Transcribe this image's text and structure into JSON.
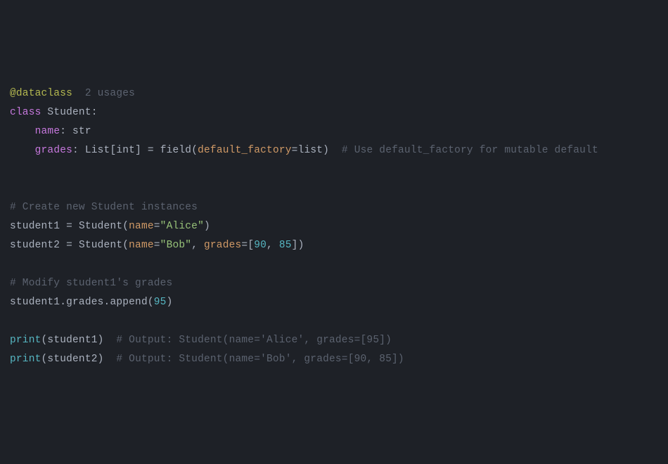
{
  "code": {
    "line1": {
      "decorator": "@dataclass",
      "usages_hint": "2 usages"
    },
    "line2": {
      "kw_class": "class",
      "classname": "Student",
      "colon": ":"
    },
    "line3": {
      "indent": "    ",
      "field": "name",
      "colon": ": ",
      "type": "str"
    },
    "line4": {
      "indent": "    ",
      "field": "grades",
      "colon": ": ",
      "type_list": "List",
      "br_open": "[",
      "type_int": "int",
      "br_close": "]",
      "eq": " = ",
      "call": "field",
      "paren_open": "(",
      "param": "default_factory",
      "eq2": "=",
      "value": "list",
      "paren_close": ")",
      "gap": "  ",
      "comment": "# Use default_factory for mutable default"
    },
    "line6": {
      "comment": "# Create new Student instances"
    },
    "line7": {
      "var": "student1",
      "eq": " = ",
      "ctor": "Student",
      "paren_open": "(",
      "kw": "name",
      "eq2": "=",
      "str": "\"Alice\"",
      "paren_close": ")"
    },
    "line8": {
      "var": "student2",
      "eq": " = ",
      "ctor": "Student",
      "paren_open": "(",
      "kw": "name",
      "eq2": "=",
      "str": "\"Bob\"",
      "comma": ", ",
      "kw2": "grades",
      "eq3": "=",
      "br_open": "[",
      "n1": "90",
      "comma2": ", ",
      "n2": "85",
      "br_close": "]",
      "paren_close": ")"
    },
    "line10": {
      "comment": "# Modify student1's grades"
    },
    "line11": {
      "obj": "student1",
      "dot": ".",
      "attr": "grades",
      "dot2": ".",
      "method": "append",
      "paren_open": "(",
      "n": "95",
      "paren_close": ")"
    },
    "line13": {
      "fn": "print",
      "paren_open": "(",
      "arg": "student1",
      "paren_close": ")",
      "gap": "  ",
      "comment": "# Output: Student(name='Alice', grades=[95])"
    },
    "line14": {
      "fn": "print",
      "paren_open": "(",
      "arg": "student2",
      "paren_close": ")",
      "gap": "  ",
      "comment": "# Output: Student(name='Bob', grades=[90, 85])"
    }
  }
}
